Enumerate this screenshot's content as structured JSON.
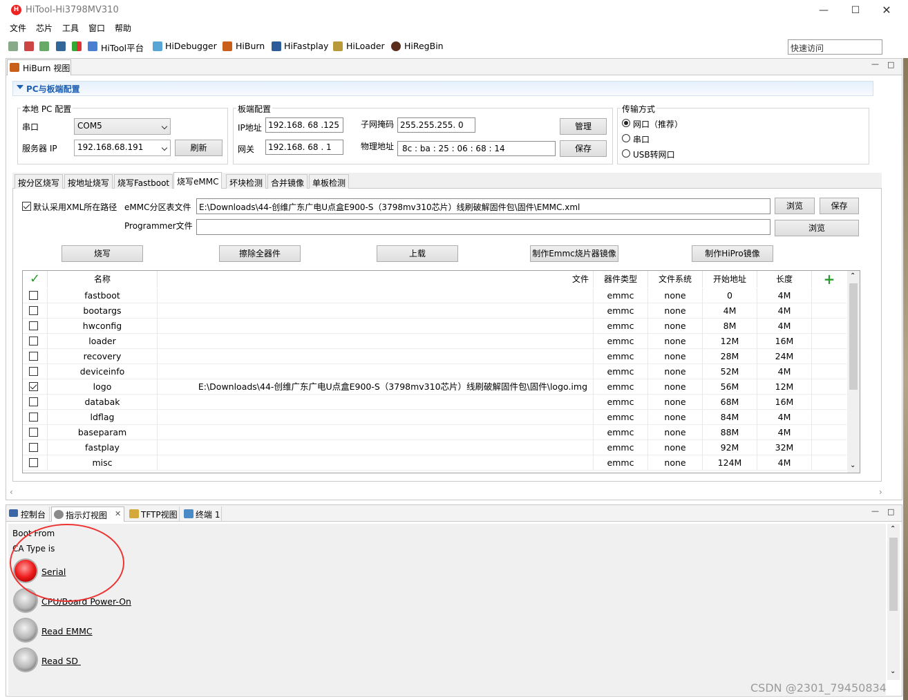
{
  "window": {
    "title": "HiTool-Hi3798MV310"
  },
  "menu": [
    "文件",
    "芯片",
    "工具",
    "窗口",
    "帮助"
  ],
  "toolbar": {
    "items": [
      "HiTool平台",
      "HiDebugger",
      "HiBurn",
      "HiFastplay",
      "HiLoader",
      "HiRegBin"
    ],
    "quick_access_placeholder": "快速访问"
  },
  "view": {
    "tab": "HiBurn 视图"
  },
  "section": {
    "title": "PC与板端配置"
  },
  "local": {
    "group": "本地 PC 配置",
    "com_label": "串口",
    "com_value": "COM5",
    "ip_label": "服务器 IP",
    "ip_value": "192.168.68.191",
    "refresh": "刷新"
  },
  "board": {
    "group": "板端配置",
    "ip_label": "IP地址",
    "ip_value": "192.168. 68 .125",
    "mask_label": "子网掩码",
    "mask_value": "255.255.255. 0",
    "gw_label": "网关",
    "gw_value": "192.168. 68 . 1",
    "mac_label": "物理地址",
    "mac_value": "8c : ba : 25 : 06 : 68 : 14",
    "manage": "管理",
    "save": "保存"
  },
  "transfer": {
    "group": "传输方式",
    "options": [
      "网口（推荐）",
      "串口",
      "USB转网口"
    ],
    "selected": 0
  },
  "tabs": [
    "按分区烧写",
    "按地址烧写",
    "烧写Fastboot",
    "烧写eMMC",
    "坏块检测",
    "合并镜像",
    "单板检测"
  ],
  "active_tab": 3,
  "emmc": {
    "xml_default_label": "默认采用XML所在路径",
    "xml_checked": true,
    "xml_label": "eMMC分区表文件",
    "xml_path": "E:\\Downloads\\44-创维广东广电U点盒E900-S（3798mv310芯片）线刷破解固件包\\固件\\EMMC.xml",
    "browse": "浏览",
    "save": "保存",
    "programmer_label": "Programmer文件",
    "programmer_path": "",
    "browse2": "浏览"
  },
  "actions": [
    "烧写",
    "擦除全器件",
    "上载",
    "制作Emmc烧片器镜像",
    "制作HiPro镜像"
  ],
  "table": {
    "headers": [
      "名称",
      "文件",
      "器件类型",
      "文件系统",
      "开始地址",
      "长度"
    ],
    "rows": [
      {
        "checked": false,
        "name": "fastboot",
        "file": "",
        "type": "emmc",
        "fs": "none",
        "start": "0",
        "len": "4M"
      },
      {
        "checked": false,
        "name": "bootargs",
        "file": "",
        "type": "emmc",
        "fs": "none",
        "start": "4M",
        "len": "4M"
      },
      {
        "checked": false,
        "name": "hwconfig",
        "file": "",
        "type": "emmc",
        "fs": "none",
        "start": "8M",
        "len": "4M"
      },
      {
        "checked": false,
        "name": "loader",
        "file": "",
        "type": "emmc",
        "fs": "none",
        "start": "12M",
        "len": "16M"
      },
      {
        "checked": false,
        "name": "recovery",
        "file": "",
        "type": "emmc",
        "fs": "none",
        "start": "28M",
        "len": "24M"
      },
      {
        "checked": false,
        "name": "deviceinfo",
        "file": "",
        "type": "emmc",
        "fs": "none",
        "start": "52M",
        "len": "4M"
      },
      {
        "checked": true,
        "name": "logo",
        "file": "E:\\Downloads\\44-创维广东广电U点盒E900-S（3798mv310芯片）线刷破解固件包\\固件\\logo.img",
        "type": "emmc",
        "fs": "none",
        "start": "56M",
        "len": "12M"
      },
      {
        "checked": false,
        "name": "databak",
        "file": "",
        "type": "emmc",
        "fs": "none",
        "start": "68M",
        "len": "16M"
      },
      {
        "checked": false,
        "name": "ldflag",
        "file": "",
        "type": "emmc",
        "fs": "none",
        "start": "84M",
        "len": "4M"
      },
      {
        "checked": false,
        "name": "baseparam",
        "file": "",
        "type": "emmc",
        "fs": "none",
        "start": "88M",
        "len": "4M"
      },
      {
        "checked": false,
        "name": "fastplay",
        "file": "",
        "type": "emmc",
        "fs": "none",
        "start": "92M",
        "len": "32M"
      },
      {
        "checked": false,
        "name": "misc",
        "file": "",
        "type": "emmc",
        "fs": "none",
        "start": "124M",
        "len": "4M"
      }
    ]
  },
  "bottom": {
    "tabs": [
      "控制台",
      "指示灯视图",
      "TFTP视图",
      "终端 1"
    ],
    "active": 1,
    "lines": [
      "Boot From",
      "CA Type is"
    ],
    "leds": [
      {
        "label": "Serial",
        "state": "red"
      },
      {
        "label": "CPU/Board Power-On",
        "state": "off"
      },
      {
        "label": "Read EMMC",
        "state": "off"
      },
      {
        "label": "Read SD ",
        "state": "off"
      }
    ]
  },
  "watermark": "CSDN @2301_79450834"
}
